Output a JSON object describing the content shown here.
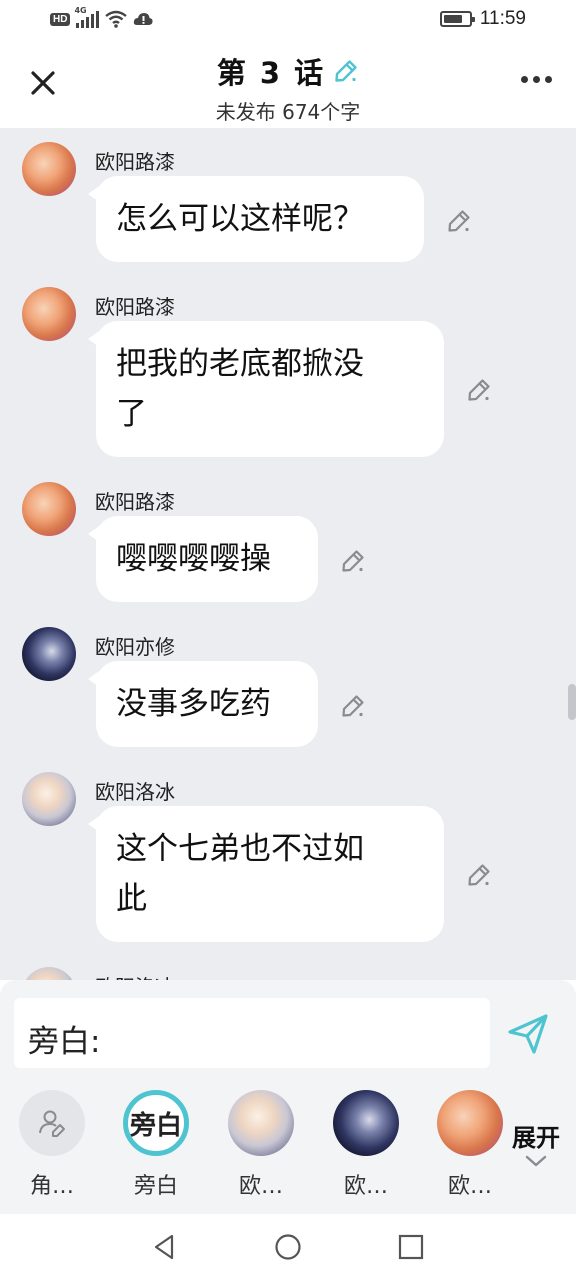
{
  "status_bar": {
    "hd": "HD",
    "network": "4G",
    "time": "11:59",
    "icons": [
      "signal-icon",
      "wifi-icon",
      "alert-icon",
      "battery-icon"
    ],
    "battery_level": 0.75
  },
  "header": {
    "title": "第 3 话",
    "subtitle": "未发布 674个字",
    "icons": [
      "close-icon",
      "pencil-icon",
      "more-icon"
    ],
    "accent": "#4fc4d1"
  },
  "messages": [
    {
      "sender": "欧阳路漆",
      "lines": [
        "怎么可以这样呢？"
      ],
      "avatar": "orange-hair-avatar"
    },
    {
      "sender": "欧阳路漆",
      "lines": [
        "把我的老底都掀没",
        "了"
      ],
      "avatar": "orange-hair-avatar"
    },
    {
      "sender": "欧阳路漆",
      "lines": [
        "嘤嘤嘤嘤操"
      ],
      "avatar": "orange-hair-avatar"
    },
    {
      "sender": "欧阳亦修",
      "lines": [
        "没事多吃药"
      ],
      "avatar": "dark-hair-avatar"
    },
    {
      "sender": "欧阳洛冰",
      "lines": [
        "这个七弟也不过如",
        "此"
      ],
      "avatar": "light-hair-avatar"
    },
    {
      "sender": "欧阳洛冰",
      "lines": [],
      "avatar": "light-hair-avatar"
    }
  ],
  "input": {
    "value": "旁白:",
    "send_icon": "send-icon"
  },
  "characters": [
    {
      "label": "角…",
      "type": "add-role",
      "icon": "add-person-icon"
    },
    {
      "label": "旁白",
      "type": "narrator",
      "text": "旁白",
      "selected": true
    },
    {
      "label": "欧…",
      "type": "avatar",
      "avatar": "light-hair-avatar"
    },
    {
      "label": "欧…",
      "type": "avatar",
      "avatar": "dark-hair-avatar"
    },
    {
      "label": "欧…",
      "type": "avatar",
      "avatar": "orange-hair-avatar"
    }
  ],
  "expand": {
    "label": "展开",
    "icon": "chevron-down-icon"
  },
  "nav": {
    "icons": [
      "back-icon",
      "home-icon",
      "recents-icon"
    ]
  }
}
